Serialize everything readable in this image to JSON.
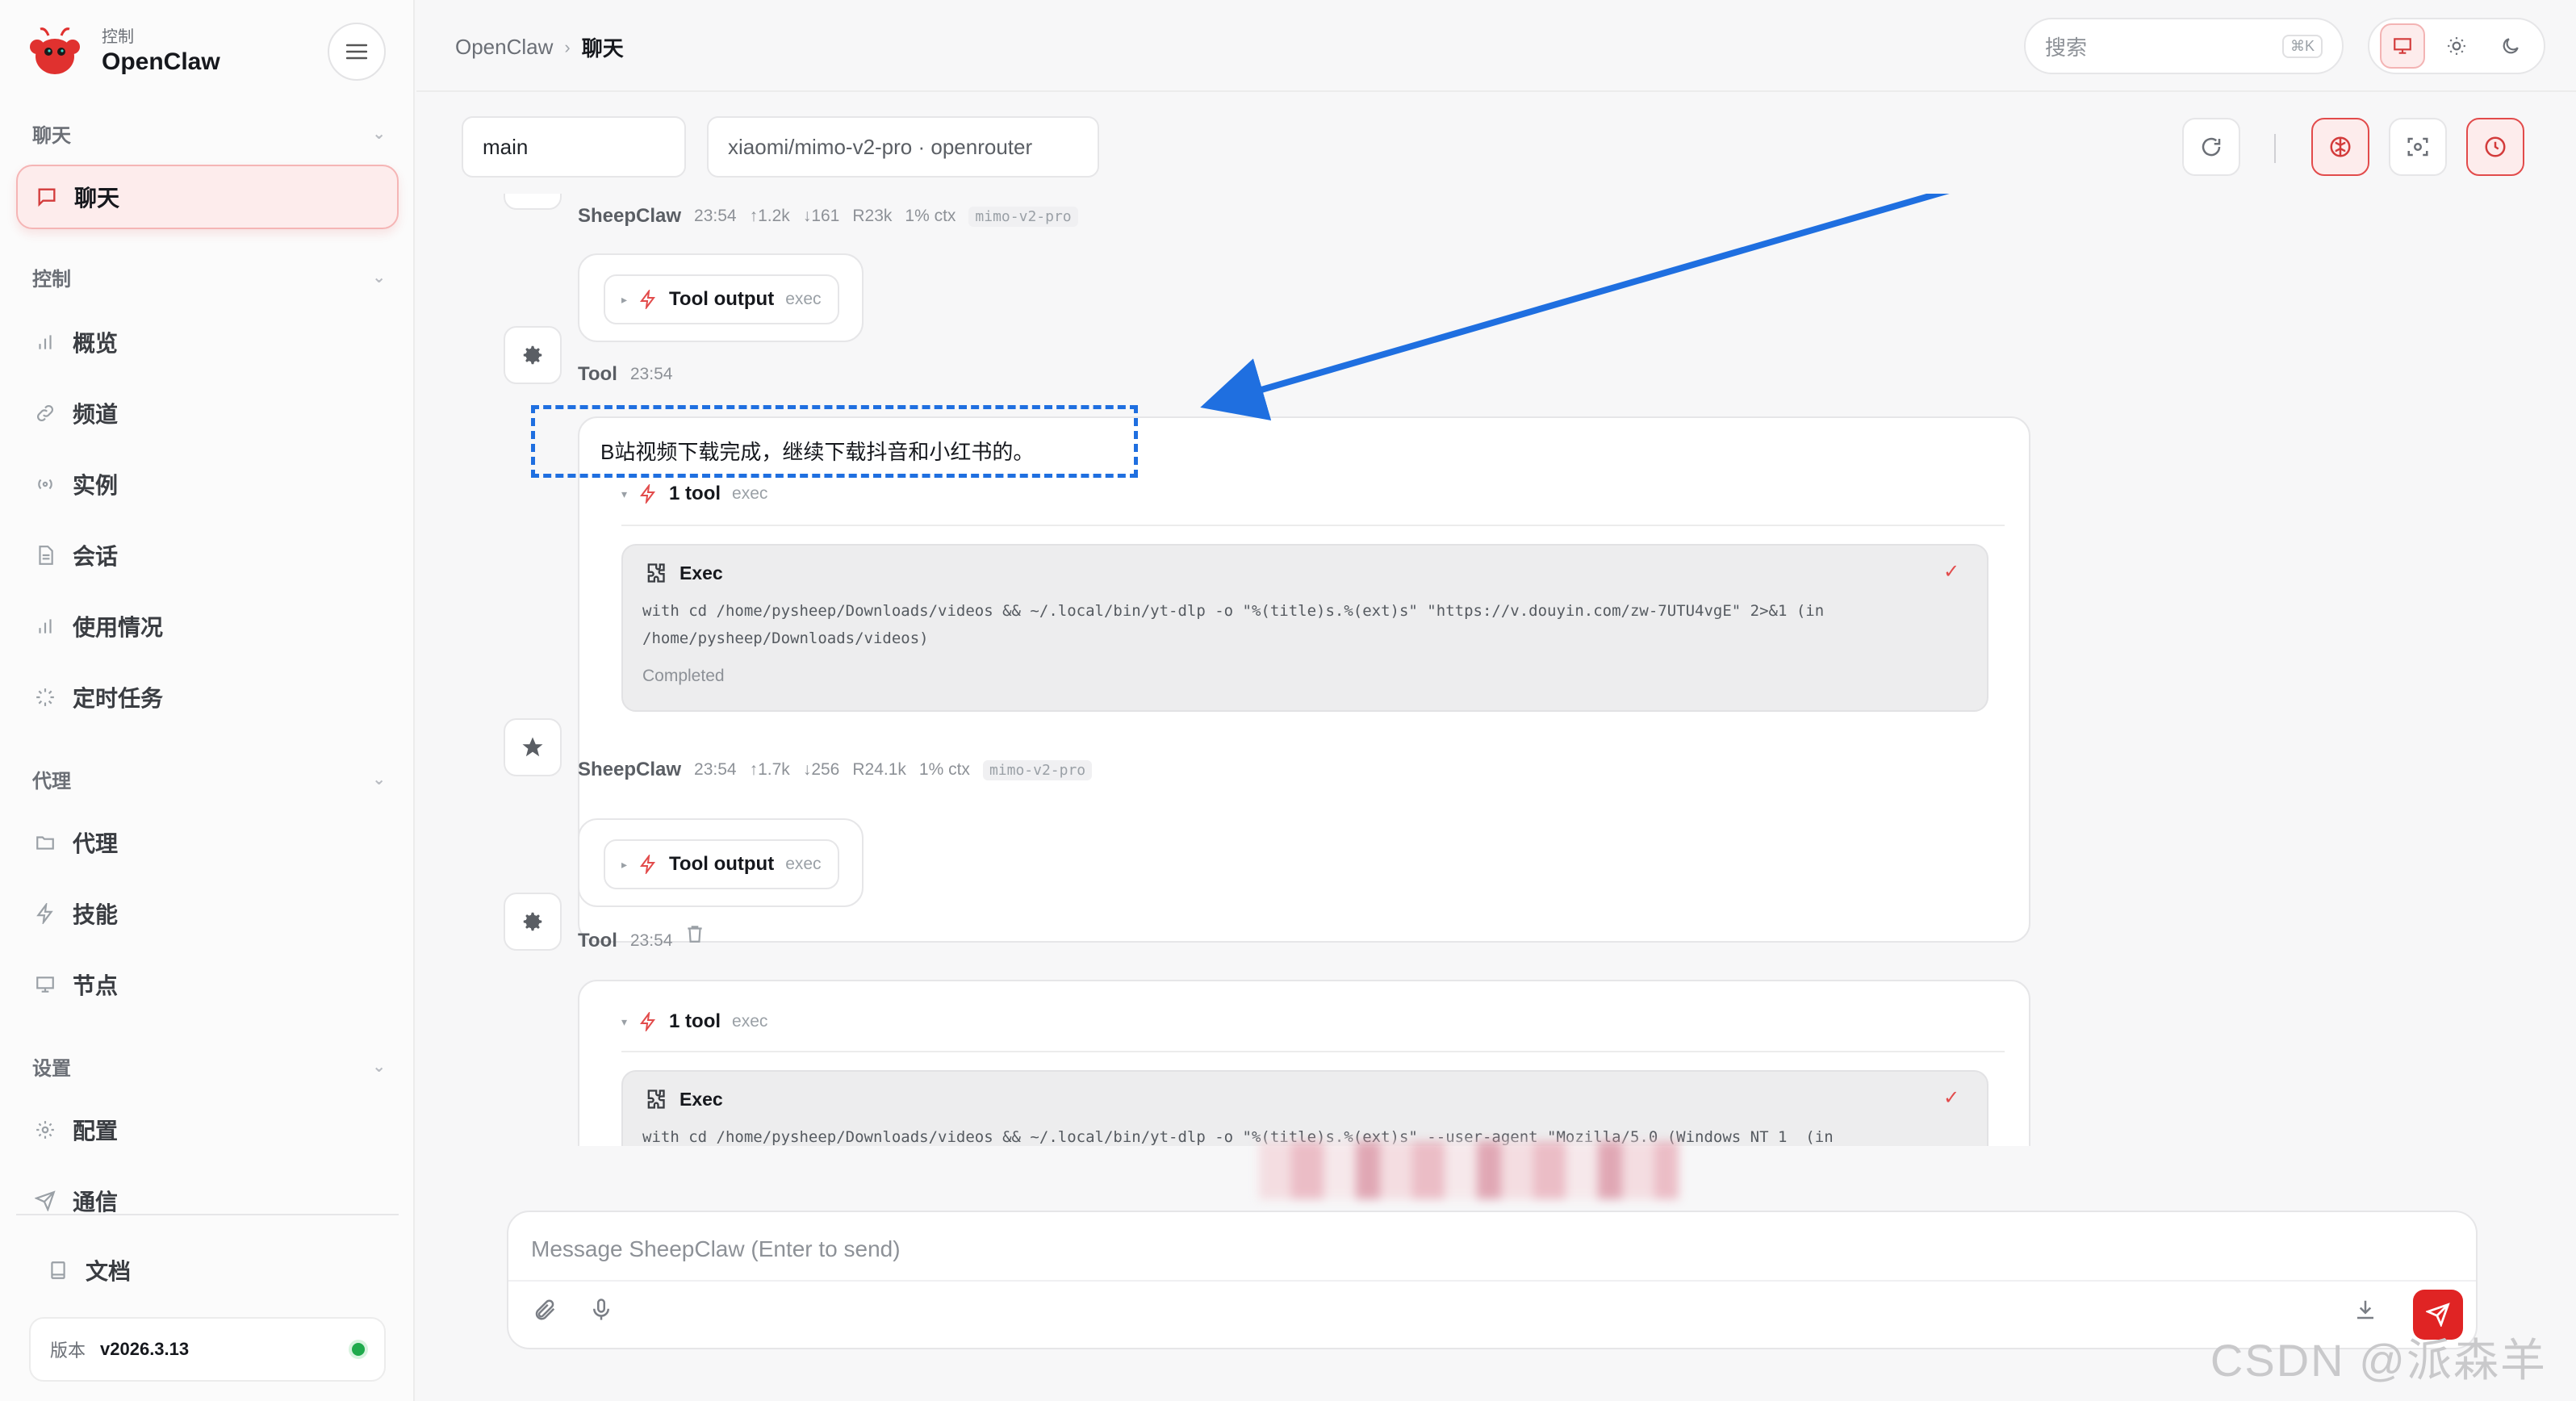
{
  "brand": {
    "sub": "控制",
    "name": "OpenClaw"
  },
  "sidebar": {
    "sections": [
      {
        "title": "聊天",
        "items": [
          {
            "label": "聊天",
            "icon": "message-icon",
            "active": true
          }
        ]
      },
      {
        "title": "控制",
        "items": [
          {
            "label": "概览",
            "icon": "bar-chart-icon"
          },
          {
            "label": "频道",
            "icon": "link-icon"
          },
          {
            "label": "实例",
            "icon": "radio-icon"
          },
          {
            "label": "会话",
            "icon": "file-icon"
          },
          {
            "label": "使用情况",
            "icon": "bar-chart-icon"
          },
          {
            "label": "定时任务",
            "icon": "loader-icon"
          }
        ]
      },
      {
        "title": "代理",
        "items": [
          {
            "label": "代理",
            "icon": "folder-icon"
          },
          {
            "label": "技能",
            "icon": "bolt-icon"
          },
          {
            "label": "节点",
            "icon": "monitor-icon"
          }
        ]
      },
      {
        "title": "设置",
        "items": [
          {
            "label": "配置",
            "icon": "gear-icon"
          },
          {
            "label": "通信",
            "icon": "send-icon"
          }
        ]
      }
    ],
    "docs_label": "文档",
    "version_label": "版本",
    "version_value": "v2026.3.13",
    "status_color": "#1faa4c"
  },
  "topbar": {
    "breadcrumb_root": "OpenClaw",
    "breadcrumb_sep": "›",
    "breadcrumb_current": "聊天",
    "search_placeholder": "搜索",
    "search_shortcut": "⌘K"
  },
  "session": {
    "name": "main",
    "model": "xiaomi/mimo-v2-pro · openrouter"
  },
  "messages": {
    "m1": {
      "who": "SheepClaw",
      "time": "23:54",
      "in": "↑1.2k",
      "out": "↓161",
      "r": "R23k",
      "ctx": "1% ctx",
      "model": "mimo-v2-pro",
      "chip_label": "Tool output",
      "chip_tag": "exec"
    },
    "t1": {
      "who": "Tool",
      "time": "23:54"
    },
    "m2": {
      "text": "B站视频下载完成，继续下载抖音和小红书的。",
      "tool_label": "1 tool",
      "tool_tag": "exec",
      "exec_title": "Exec",
      "exec_code": "with cd /home/pysheep/Downloads/videos && ~/.local/bin/yt-dlp -o \"%(title)s.%(ext)s\" \"https://v.douyin.com/zw-7UTU4vgE\" 2>&1 (in\n/home/pysheep/Downloads/videos)",
      "exec_status": "Completed"
    },
    "m3": {
      "who": "SheepClaw",
      "time": "23:54",
      "in": "↑1.7k",
      "out": "↓256",
      "r": "R24.1k",
      "ctx": "1% ctx",
      "model": "mimo-v2-pro",
      "chip_label": "Tool output",
      "chip_tag": "exec"
    },
    "t2": {
      "who": "Tool",
      "time": "23:54"
    },
    "m4": {
      "tool_label": "1 tool",
      "tool_tag": "exec",
      "exec_title": "Exec",
      "exec_code": "with cd /home/pysheep/Downloads/videos && ~/.local/bin/yt-dlp -o \"%(title)s.%(ext)s\" --user-agent \"Mozilla/5.0 (Windows NT 1  (in"
    }
  },
  "composer": {
    "placeholder": "Message SheepClaw (Enter to send)"
  },
  "watermark": "CSDN @派森羊",
  "colors": {
    "accent": "#e02424",
    "annotation": "#1f6fe0"
  }
}
